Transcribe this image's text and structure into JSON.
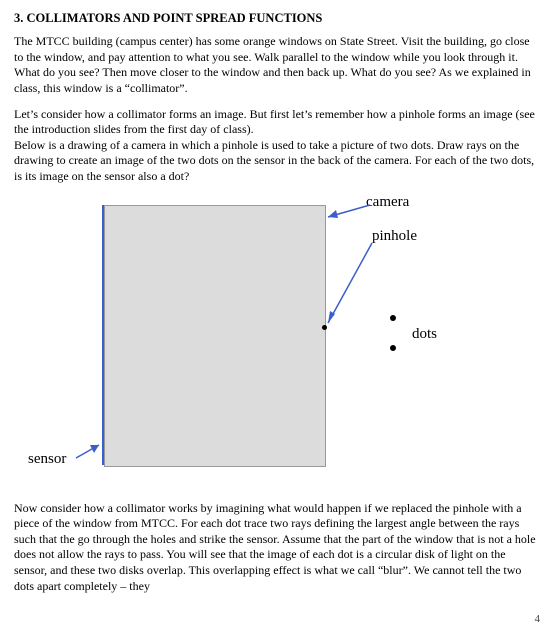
{
  "heading": "3. COLLIMATORS AND POINT SPREAD FUNCTIONS",
  "para1": "The MTCC building (campus center) has some orange windows on State Street.  Visit the building, go close to the window, and pay attention to what you see.  Walk parallel to the window while you look through it.  What do you see?  Then move closer to the window and then back up.  What do you see?  As we explained in class, this window is a “collimator”.",
  "para2": "Let’s consider how a collimator forms an image.  But first let’s remember how a pinhole forms an image (see the introduction slides from the first day of class).",
  "para3": "Below is a drawing of a camera in which a pinhole is used to take a picture of two dots.  Draw rays on the drawing to create an image of the two dots on the sensor in the back of the camera.  For each of the two dots, is its image on the sensor also a dot?",
  "diagram": {
    "label_camera": "camera",
    "label_pinhole": "pinhole",
    "label_dots": "dots",
    "label_sensor": "sensor"
  },
  "para4": "Now consider how a collimator works by imagining what would happen if we replaced the pinhole with a piece of the window from MTCC.  For each dot trace two rays defining the largest angle between the rays such that the go through the holes and strike the sensor.  Assume that the part of the window that is not a hole does not allow the rays to pass.  You will see that the image of each dot is a circular disk of light on the sensor, and these two disks overlap.  This overlapping effect is what we call “blur”.  We cannot tell the two dots apart completely – they",
  "page_number": "4"
}
